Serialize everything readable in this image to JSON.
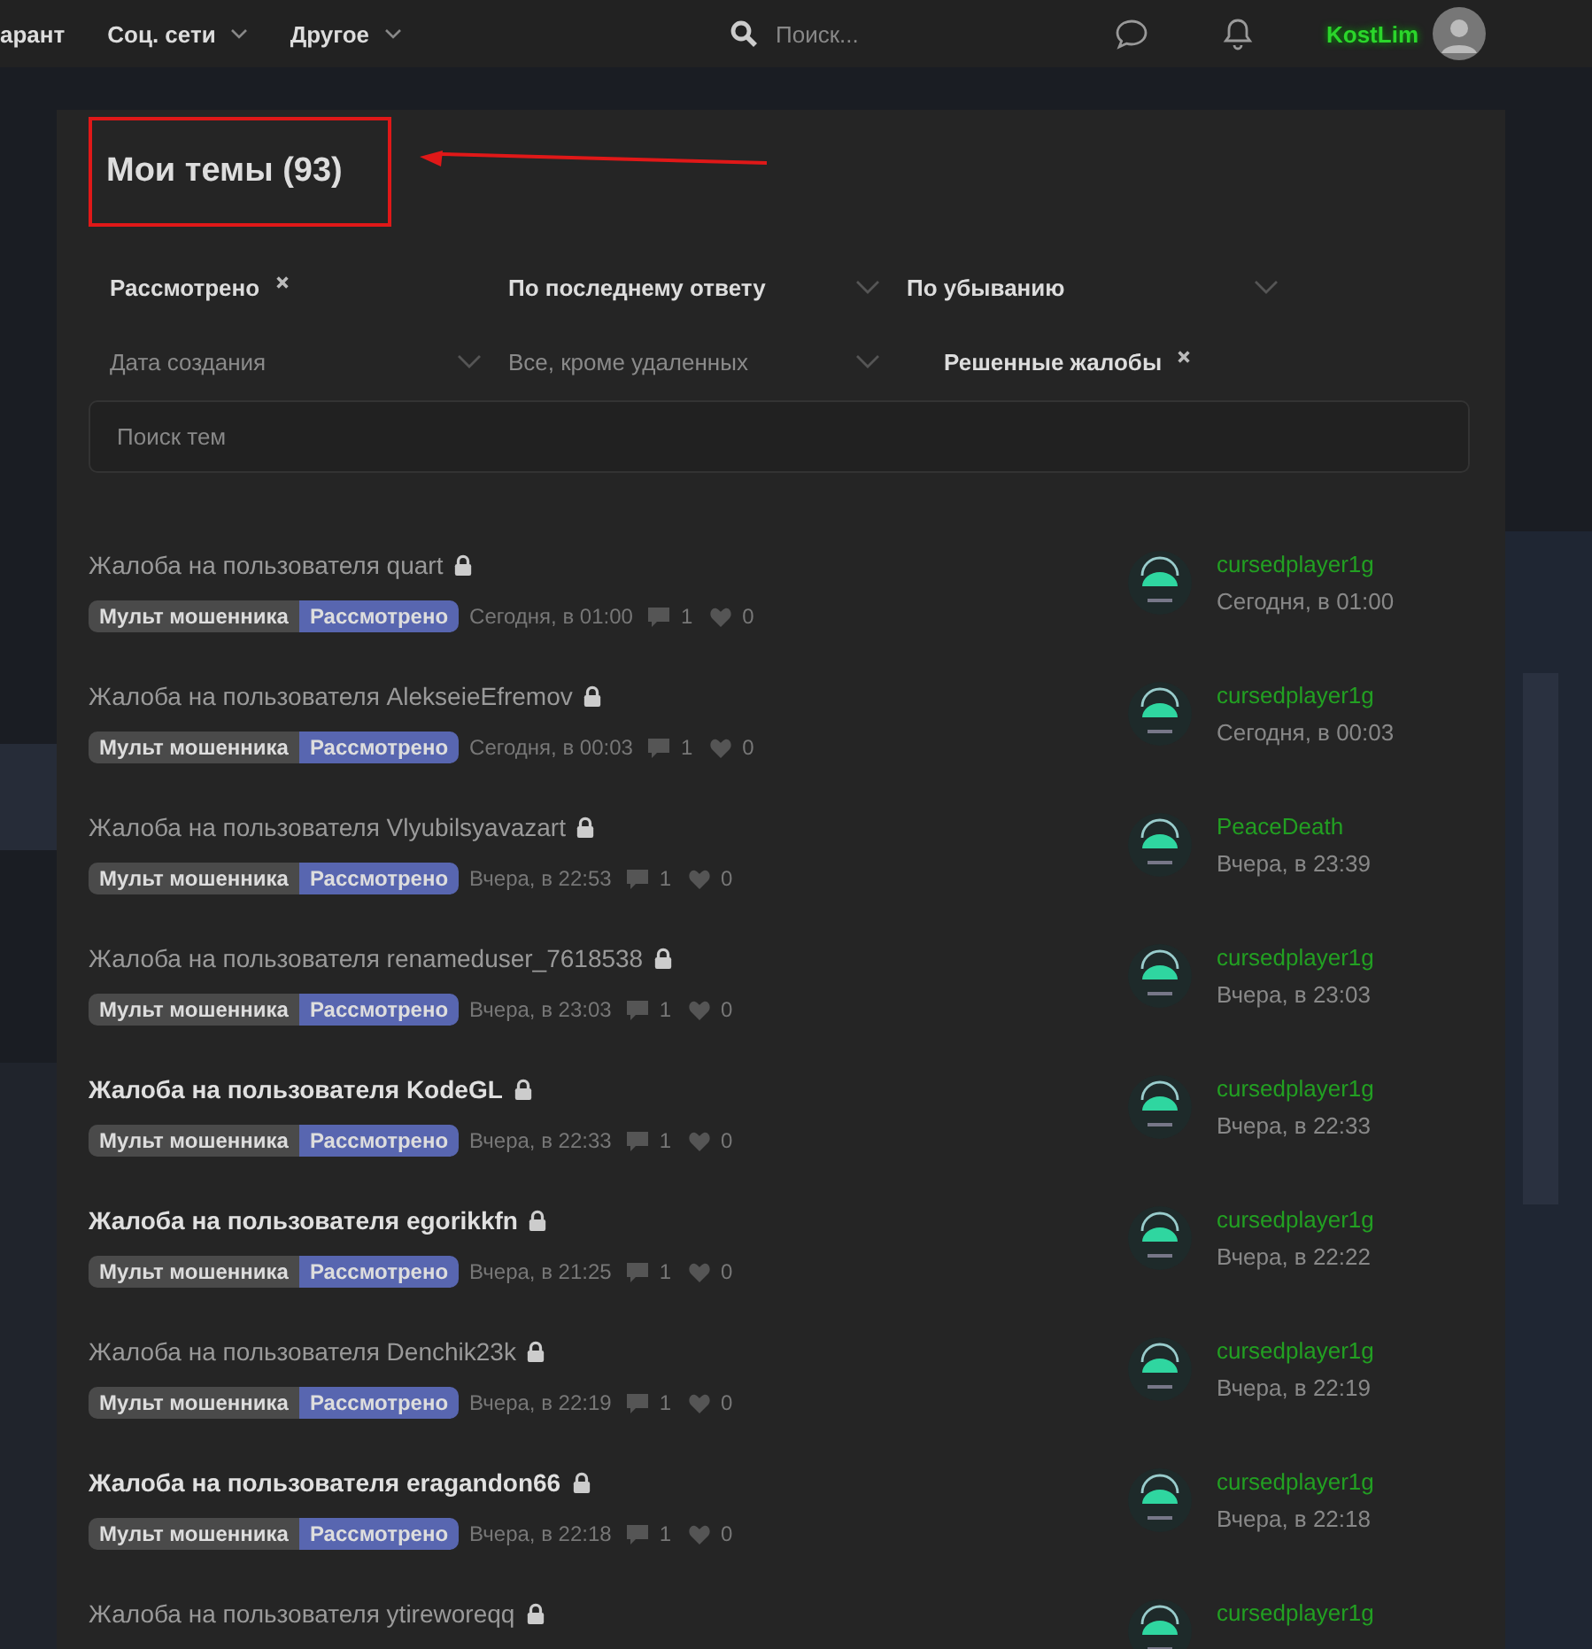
{
  "nav": {
    "items": [
      {
        "label": "арант",
        "dropdown": false
      },
      {
        "label": "Соц. сети",
        "dropdown": true
      },
      {
        "label": "Другое",
        "dropdown": true
      }
    ],
    "search": {
      "placeholder": "Поиск..."
    },
    "user": "KostLim"
  },
  "heading": {
    "title": "Мои темы (93)"
  },
  "filters": [
    {
      "kind": "chip",
      "label": "Рассмотрено",
      "active": true
    },
    {
      "kind": "select",
      "label": "По последнему ответу",
      "active": true
    },
    {
      "kind": "select",
      "label": "По убыванию",
      "active": true
    },
    {
      "kind": "select",
      "label": "Дата создания",
      "active": false
    },
    {
      "kind": "select",
      "label": "Все, кроме удаленных",
      "active": false
    },
    {
      "kind": "chip",
      "label": "Решенные жалобы",
      "active": true
    }
  ],
  "search": {
    "placeholder": "Поиск тем"
  },
  "threads": [
    {
      "title": "Жалоба на пользователя quart",
      "unread": false,
      "tags": [
        "Мульт мошенника",
        "Рассмотрено"
      ],
      "date": "Сегодня, в 01:00",
      "replies": "1",
      "likes": "0",
      "last_user": "cursedplayer1g",
      "last_date": "Сегодня, в 01:00"
    },
    {
      "title": "Жалоба на пользователя AlekseieEfremov",
      "unread": false,
      "tags": [
        "Мульт мошенника",
        "Рассмотрено"
      ],
      "date": "Сегодня, в 00:03",
      "replies": "1",
      "likes": "0",
      "last_user": "cursedplayer1g",
      "last_date": "Сегодня, в 00:03"
    },
    {
      "title": "Жалоба на пользователя Vlyubilsyavazart",
      "unread": false,
      "tags": [
        "Мульт мошенника",
        "Рассмотрено"
      ],
      "date": "Вчера, в 22:53",
      "replies": "1",
      "likes": "0",
      "last_user": "PeaceDeath",
      "last_date": "Вчера, в 23:39"
    },
    {
      "title": "Жалоба на пользователя renameduser_7618538",
      "unread": false,
      "tags": [
        "Мульт мошенника",
        "Рассмотрено"
      ],
      "date": "Вчера, в 23:03",
      "replies": "1",
      "likes": "0",
      "last_user": "cursedplayer1g",
      "last_date": "Вчера, в 23:03"
    },
    {
      "title": "Жалоба на пользователя KodeGL",
      "unread": true,
      "tags": [
        "Мульт мошенника",
        "Рассмотрено"
      ],
      "date": "Вчера, в 22:33",
      "replies": "1",
      "likes": "0",
      "last_user": "cursedplayer1g",
      "last_date": "Вчера, в 22:33"
    },
    {
      "title": "Жалоба на пользователя egorikkfn",
      "unread": true,
      "tags": [
        "Мульт мошенника",
        "Рассмотрено"
      ],
      "date": "Вчера, в 21:25",
      "replies": "1",
      "likes": "0",
      "last_user": "cursedplayer1g",
      "last_date": "Вчера, в 22:22"
    },
    {
      "title": "Жалоба на пользователя Denchik23k",
      "unread": false,
      "tags": [
        "Мульт мошенника",
        "Рассмотрено"
      ],
      "date": "Вчера, в 22:19",
      "replies": "1",
      "likes": "0",
      "last_user": "cursedplayer1g",
      "last_date": "Вчера, в 22:19"
    },
    {
      "title": "Жалоба на пользователя eragandon66",
      "unread": true,
      "tags": [
        "Мульт мошенника",
        "Рассмотрено"
      ],
      "date": "Вчера, в 22:18",
      "replies": "1",
      "likes": "0",
      "last_user": "cursedplayer1g",
      "last_date": "Вчера, в 22:18"
    },
    {
      "title": "Жалоба на пользователя ytireworeqq",
      "unread": false,
      "last_user": "cursedplayer1g"
    }
  ]
}
